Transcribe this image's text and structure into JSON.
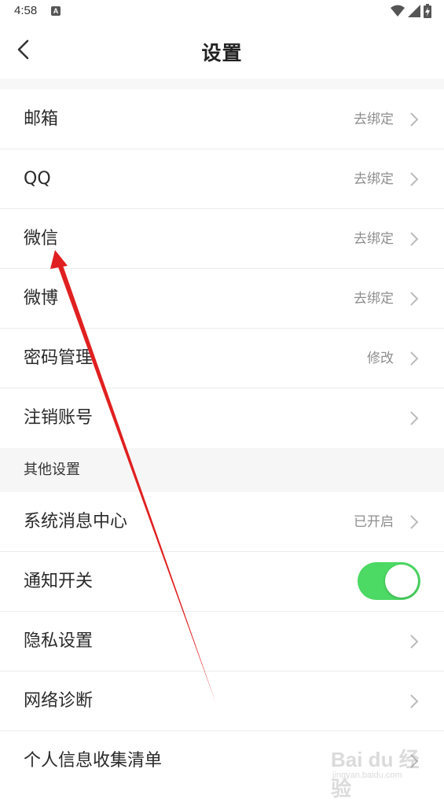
{
  "status_bar": {
    "time": "4:58",
    "notification_icon": "a-icon",
    "wifi_icon": "wifi-icon",
    "signal_icon": "signal-icon",
    "battery_icon": "battery-charging-icon"
  },
  "header": {
    "title": "设置",
    "back_icon": "chevron-left-icon"
  },
  "account_rows": [
    {
      "label": "邮箱",
      "value": "去绑定"
    },
    {
      "label": "QQ",
      "value": "去绑定"
    },
    {
      "label": "微信",
      "value": "去绑定"
    },
    {
      "label": "微博",
      "value": "去绑定"
    },
    {
      "label": "密码管理",
      "value": "修改"
    },
    {
      "label": "注销账号",
      "value": ""
    }
  ],
  "other_section": {
    "title": "其他设置",
    "rows": [
      {
        "label": "系统消息中心",
        "value": "已开启",
        "type": "link"
      },
      {
        "label": "通知开关",
        "type": "toggle",
        "on": true
      },
      {
        "label": "隐私设置",
        "value": "",
        "type": "link"
      },
      {
        "label": "网络诊断",
        "value": "",
        "type": "link"
      },
      {
        "label": "个人信息收集清单",
        "value": "",
        "type": "link"
      }
    ]
  },
  "colors": {
    "toggle_on": "#4cd964",
    "annotation_arrow": "#e02020",
    "section_bg": "#f6f6f6"
  },
  "watermark": {
    "brand": "Bai du 经验",
    "url": "jingyan.baidu.com"
  }
}
